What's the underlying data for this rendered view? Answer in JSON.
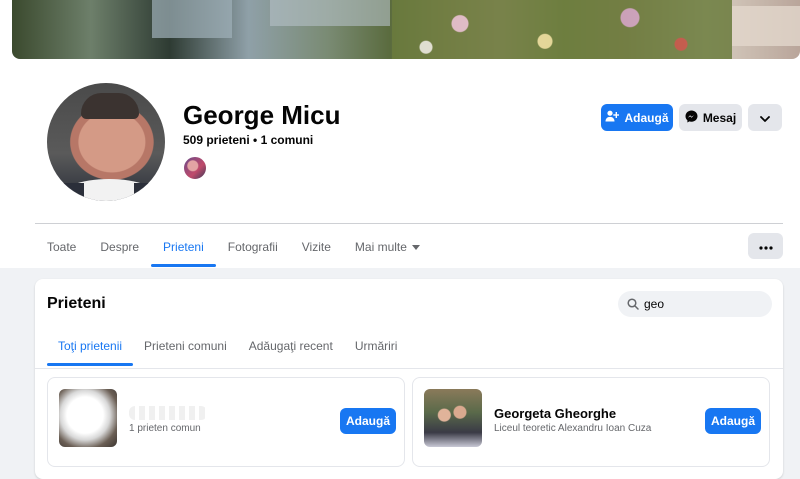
{
  "profile": {
    "name": "George Micu",
    "friends_summary": "509 prieteni • 1 comuni",
    "actions": {
      "add_label": "Adaugă",
      "message_label": "Mesaj"
    }
  },
  "nav": {
    "tabs": [
      {
        "label": "Toate"
      },
      {
        "label": "Despre"
      },
      {
        "label": "Prieteni"
      },
      {
        "label": "Fotografii"
      },
      {
        "label": "Vizite"
      },
      {
        "label": "Mai multe"
      }
    ],
    "active_tab": "Prieteni"
  },
  "friends_section": {
    "title": "Prieteni",
    "search": {
      "value": "geo"
    },
    "tabs": [
      {
        "label": "Toţi prietenii"
      },
      {
        "label": "Prieteni comuni"
      },
      {
        "label": "Adăugaţi recent"
      },
      {
        "label": "Urmăriri"
      }
    ],
    "active_tab": "Toţi prietenii",
    "items": [
      {
        "name": "",
        "subtitle": "1 prieten comun",
        "button_label": "Adaugă"
      },
      {
        "name": "Georgeta Gheorghe",
        "subtitle": "Liceul teoretic Alexandru Ioan Cuza",
        "button_label": "Adaugă"
      }
    ]
  },
  "colors": {
    "accent": "#1877f2",
    "page_bg": "#f0f2f5",
    "secondary_button": "#e4e6eb",
    "muted_text": "#65676b"
  }
}
